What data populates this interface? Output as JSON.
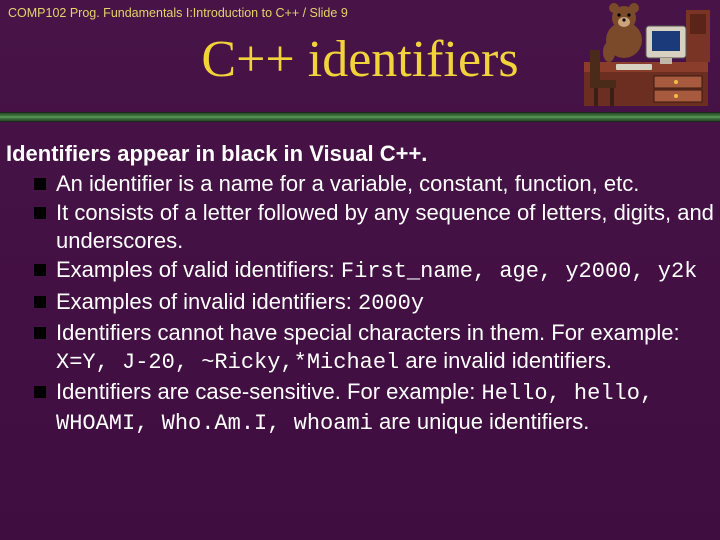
{
  "header": {
    "label": "COMP102 Prog. Fundamentals I:Introduction to C++ / Slide 9"
  },
  "title": "C++ identifiers",
  "lead": "Identifiers appear in black in Visual C++.",
  "bullets": {
    "b1": "An identifier is a name for a variable, constant, function, etc.",
    "b2": "It consists of a letter followed by any sequence of letters, digits, and underscores.",
    "b3_pre": "Examples of valid identifiers: ",
    "b3_code": "First_name, age, y2000,  y2k",
    "b4_pre": "Examples of invalid identifiers: ",
    "b4_code": "2000y",
    "b5_pre": "Identifiers cannot have special characters in them. For example: ",
    "b5_code": "X=Y, J-20, ~Ricky,*Michael",
    "b5_post": " are invalid identifiers.",
    "b6_pre": "Identifiers are case-sensitive.  For example: ",
    "b6_code": "Hello, hello, WHOAMI, Who.Am.I, whoami",
    "b6_post": " are unique identifiers."
  }
}
